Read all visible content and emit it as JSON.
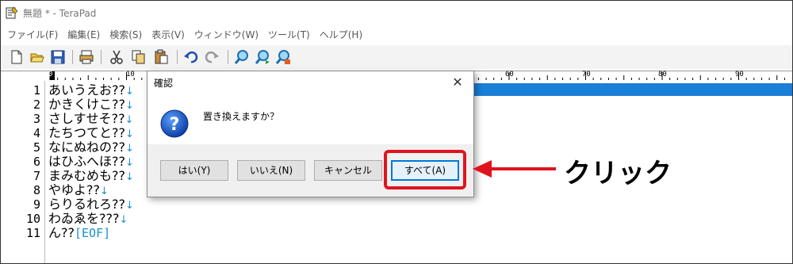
{
  "window": {
    "title": "無題 * - TeraPad"
  },
  "menu": {
    "items": [
      {
        "label": "ファイル(F)"
      },
      {
        "label": "編集(E)"
      },
      {
        "label": "検索(S)"
      },
      {
        "label": "表示(V)"
      },
      {
        "label": "ウィンドウ(W)"
      },
      {
        "label": "ツール(T)"
      },
      {
        "label": "ヘルプ(H)"
      }
    ]
  },
  "toolbar": {
    "buttons": [
      "new-file-icon",
      "open-folder-icon",
      "save-icon",
      "print-icon",
      "cut-icon",
      "copy-icon",
      "paste-icon",
      "undo-icon",
      "redo-icon",
      "find-icon",
      "find-next-icon",
      "replace-icon"
    ]
  },
  "ruler": {
    "labels": [
      "0",
      "10",
      "60",
      "70",
      "80",
      "90"
    ]
  },
  "editor": {
    "lines": [
      {
        "num": "1",
        "text": "あいうえお??",
        "end": "↓"
      },
      {
        "num": "2",
        "text": "かきくけこ??",
        "end": "↓"
      },
      {
        "num": "3",
        "text": "さしすせそ??",
        "end": "↓"
      },
      {
        "num": "4",
        "text": "たちつてと??",
        "end": "↓"
      },
      {
        "num": "5",
        "text": "なにぬねの??",
        "end": "↓"
      },
      {
        "num": "6",
        "text": "はひふへほ??",
        "end": "↓"
      },
      {
        "num": "7",
        "text": "まみむめも??",
        "end": "↓"
      },
      {
        "num": "8",
        "text": "やゆよ??",
        "end": "↓"
      },
      {
        "num": "9",
        "text": "らりるれろ??",
        "end": "↓"
      },
      {
        "num": "10",
        "text": "わゐゑを???",
        "end": "↓"
      },
      {
        "num": "11",
        "text": "ん??",
        "end": "[EOF]"
      }
    ]
  },
  "dialog": {
    "title": "確認",
    "close": "✕",
    "message": "置き換えますか？",
    "icon": "question-icon",
    "buttons": {
      "yes": "はい(Y)",
      "no": "いいえ(N)",
      "cancel": "キャンセル",
      "all": "すべて(A)"
    }
  },
  "annotation": {
    "label": "クリック",
    "color": "#e0141e"
  }
}
